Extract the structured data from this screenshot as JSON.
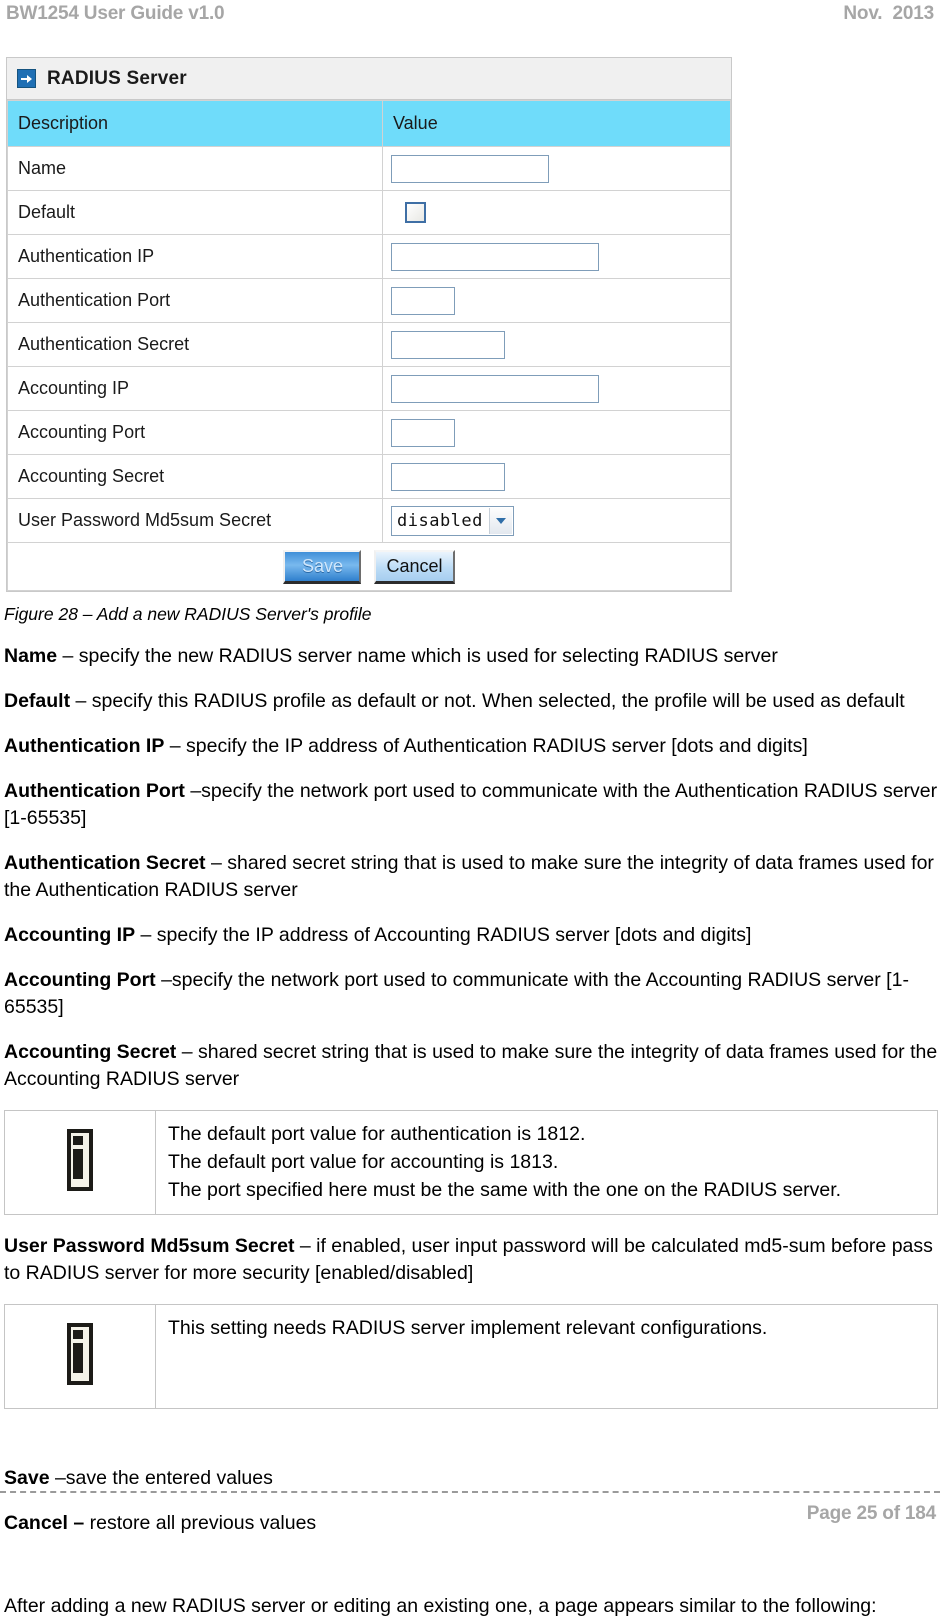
{
  "header": {
    "left": "BW1254 User Guide v1.0",
    "right": "Nov.  2013"
  },
  "figure": {
    "panel_title": "RADIUS Server",
    "columns": {
      "description": "Description",
      "value": "Value"
    },
    "rows": [
      {
        "label": "Name",
        "control": "textbox",
        "value": ""
      },
      {
        "label": "Default",
        "control": "checkbox",
        "value": ""
      },
      {
        "label": "Authentication IP",
        "control": "textbox",
        "value": ""
      },
      {
        "label": "Authentication Port",
        "control": "textbox",
        "value": ""
      },
      {
        "label": "Authentication Secret",
        "control": "textbox",
        "value": ""
      },
      {
        "label": "Accounting IP",
        "control": "textbox",
        "value": ""
      },
      {
        "label": "Accounting Port",
        "control": "textbox",
        "value": ""
      },
      {
        "label": "Accounting Secret",
        "control": "textbox",
        "value": ""
      },
      {
        "label": "User Password Md5sum Secret",
        "control": "select",
        "value": "disabled"
      }
    ],
    "select_value": "disabled",
    "buttons": {
      "save": "Save",
      "cancel": "Cancel"
    },
    "accent_cyan": "#6fdcfa",
    "accent_blue": "#2f7fcd"
  },
  "caption": "Figure 28 – Add a new RADIUS Server's profile",
  "paragraphs": [
    {
      "term": "Name",
      "rest": " – specify the new RADIUS server name which is used for selecting RADIUS server"
    },
    {
      "term": "Default",
      "rest": " – specify this RADIUS profile as default or not. When selected, the profile will be used as default"
    },
    {
      "term": "Authentication IP",
      "rest": " – specify the IP address of Authentication RADIUS server [dots and digits]"
    },
    {
      "term": "Authentication Port",
      "rest": " –specify the network port used to communicate with the Authentication RADIUS server [1-65535]"
    },
    {
      "term": "Authentication Secret",
      "rest": " – shared secret string that is used to make sure the integrity of data frames used for the Authentication RADIUS server"
    },
    {
      "term": "Accounting IP",
      "rest": " – specify the IP address of Accounting RADIUS server [dots and digits]"
    },
    {
      "term": "Accounting Port",
      "rest": " –specify the network port used to communicate with the Accounting RADIUS server [1-65535]"
    },
    {
      "term": "Accounting Secret",
      "rest": " – shared secret string that is used to make sure the integrity of data frames used for the Accounting RADIUS server"
    }
  ],
  "note_1": {
    "icon": "info-icon",
    "line_1": "The default port value for authentication is 1812.",
    "line_2": "The default port value for accounting is 1813.",
    "line_3": "The port specified here must be the same with the one on the RADIUS server."
  },
  "md5_paragraph": {
    "term": "User Password Md5sum Secret",
    "rest": " – if enabled, user input password will be calculated md5-sum before pass to RADIUS server for more security [enabled/disabled]"
  },
  "note_2": {
    "icon": "info-icon",
    "line_1": "This setting needs RADIUS server implement relevant configurations."
  },
  "button_paragraphs": [
    {
      "term": "Save",
      "rest": " –save the entered values"
    },
    {
      "term": "Cancel –",
      "rest": " restore all previous values"
    }
  ],
  "closing_paragraph": "After adding a new RADIUS server or editing an existing one, a page appears similar to the following:",
  "footer": {
    "page": "Page 25 of 184"
  }
}
